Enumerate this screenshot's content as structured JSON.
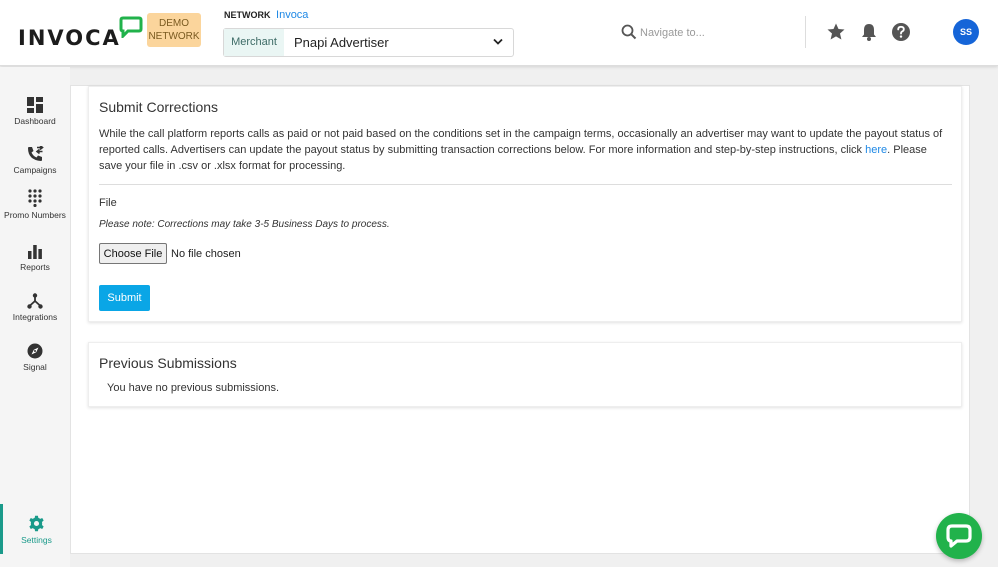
{
  "brand": {
    "logo_text": "INVOCA",
    "demo_badge": "DEMO NETWORK",
    "accent_color": "#1a9a8a",
    "logo_bubble_color": "#21b24b"
  },
  "header": {
    "network_label": "NETWORK",
    "network_name": "Invoca",
    "merchant_label": "Merchant",
    "merchant_value": "Pnapi Advertiser",
    "search_placeholder": "Navigate to...",
    "avatar_initials": "SS",
    "icons": [
      "star-icon",
      "bell-icon",
      "help-icon"
    ]
  },
  "sidebar": {
    "items": [
      {
        "label": "Dashboard",
        "icon": "dashboard-icon"
      },
      {
        "label": "Campaigns",
        "icon": "campaigns-icon"
      },
      {
        "label": "Promo Numbers",
        "icon": "dialpad-icon"
      },
      {
        "label": "Reports",
        "icon": "bar-chart-icon"
      },
      {
        "label": "Integrations",
        "icon": "integrations-icon"
      },
      {
        "label": "Signal",
        "icon": "compass-icon"
      },
      {
        "label": "Settings",
        "icon": "gear-icon",
        "active": true
      }
    ]
  },
  "corrections": {
    "title": "Submit Corrections",
    "description_before": "While the call platform reports calls as paid or not paid based on the conditions set in the campaign terms, occasionally an advertiser may want to update the payout status of reported calls. Advertisers can update the payout status by submitting transaction corrections below. For more information and step-by-step instructions, click ",
    "link_text": "here",
    "description_after": ". Please save your file in .csv or .xlsx format for processing.",
    "file_label": "File",
    "note": "Please note: Corrections may take 3-5 Business Days to process.",
    "choose_file_label": "Choose File",
    "no_file_text": "No file chosen",
    "submit_label": "Submit"
  },
  "previous": {
    "title": "Previous Submissions",
    "empty_message": "You have no previous submissions."
  }
}
